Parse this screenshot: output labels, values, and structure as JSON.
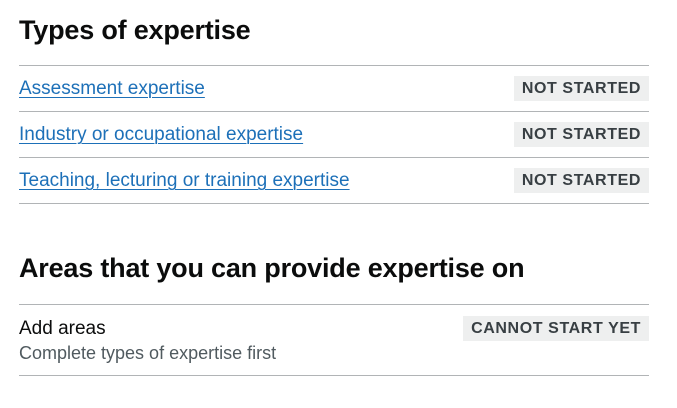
{
  "types_section": {
    "heading": "Types of expertise",
    "tasks": [
      {
        "label": "Assessment expertise",
        "status": "NOT STARTED"
      },
      {
        "label": "Industry or occupational expertise",
        "status": "NOT STARTED"
      },
      {
        "label": "Teaching, lecturing or training expertise",
        "status": "NOT STARTED"
      }
    ]
  },
  "areas_section": {
    "heading": "Areas that you can provide expertise on",
    "task": {
      "label": "Add areas",
      "hint": "Complete types of expertise first",
      "status": "CANNOT START YET"
    }
  },
  "colors": {
    "link": "#1d70b8",
    "text": "#0b0c0c",
    "hint": "#505a5f",
    "tag_bg": "#eeefef",
    "tag_text": "#383f43",
    "divider": "#b1b4b6"
  }
}
